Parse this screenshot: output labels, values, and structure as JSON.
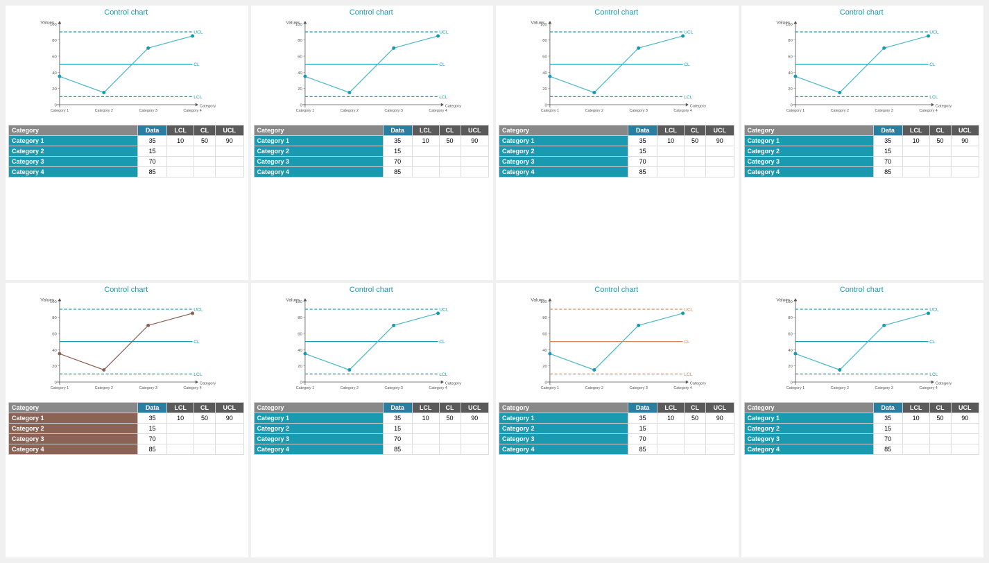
{
  "charts": [
    {
      "id": "c1",
      "title": "Control chart",
      "theme": "teal",
      "lineColor": "#4ab8c8",
      "pointColor": "#1a9ab0",
      "data": [
        35,
        15,
        70,
        85
      ],
      "lcl": 10,
      "cl": 50,
      "ucl": 90,
      "clColor": "#1a9ab0",
      "uclColor": "#1a9ab0",
      "lclColor": "#1a9ab0"
    },
    {
      "id": "c2",
      "title": "Control chart",
      "theme": "teal",
      "lineColor": "#4ab8c8",
      "pointColor": "#1a9ab0",
      "data": [
        35,
        15,
        70,
        85
      ],
      "lcl": 10,
      "cl": 50,
      "ucl": 90,
      "clColor": "#1a9ab0",
      "uclColor": "#1a9ab0",
      "lclColor": "#1a9ab0"
    },
    {
      "id": "c3",
      "title": "Control chart",
      "theme": "teal",
      "lineColor": "#4ab8c8",
      "pointColor": "#1a9ab0",
      "data": [
        35,
        15,
        70,
        85
      ],
      "lcl": 10,
      "cl": 50,
      "ucl": 90,
      "clColor": "#1a9ab0",
      "uclColor": "#1a9ab0",
      "lclColor": "#1a9ab0"
    },
    {
      "id": "c4",
      "title": "Control chart",
      "theme": "teal",
      "lineColor": "#4ab8c8",
      "pointColor": "#1a9ab0",
      "data": [
        35,
        15,
        70,
        85
      ],
      "lcl": 10,
      "cl": 50,
      "ucl": 90,
      "clColor": "#1a9ab0",
      "uclColor": "#1a9ab0",
      "lclColor": "#1a9ab0"
    },
    {
      "id": "c5",
      "title": "Control chart",
      "theme": "brown",
      "lineColor": "#8b6355",
      "pointColor": "#8b6355",
      "data": [
        35,
        15,
        70,
        85
      ],
      "lcl": 10,
      "cl": 50,
      "ucl": 90,
      "clColor": "#1a9ab0",
      "uclColor": "#1a9ab0",
      "lclColor": "#1a9ab0"
    },
    {
      "id": "c6",
      "title": "Control chart",
      "theme": "teal",
      "lineColor": "#4ab8c8",
      "pointColor": "#1a9ab0",
      "data": [
        35,
        15,
        70,
        85
      ],
      "lcl": 10,
      "cl": 50,
      "ucl": 90,
      "clColor": "#1a9ab0",
      "uclColor": "#1a9ab0",
      "lclColor": "#1a9ab0"
    },
    {
      "id": "c7",
      "title": "Control chart",
      "theme": "teal",
      "lineColor": "#4ab8c8",
      "pointColor": "#1a9ab0",
      "data": [
        35,
        15,
        70,
        85
      ],
      "lcl": 10,
      "cl": 50,
      "ucl": 90,
      "clColor": "#d4875a",
      "uclColor": "#d4875a",
      "lclColor": "#d4875a"
    },
    {
      "id": "c8",
      "title": "Control chart",
      "theme": "teal",
      "lineColor": "#4ab8c8",
      "pointColor": "#1a9ab0",
      "data": [
        35,
        15,
        70,
        85
      ],
      "lcl": 10,
      "cl": 50,
      "ucl": 90,
      "clColor": "#1a9ab0",
      "uclColor": "#1a9ab0",
      "lclColor": "#1a9ab0"
    }
  ],
  "categories": [
    "Category 1",
    "Category 2",
    "Category 3",
    "Category 4"
  ],
  "tableHeaders": {
    "category": "Category",
    "data": "Data",
    "lcl": "LCL",
    "cl": "CL",
    "ucl": "UCL"
  },
  "axisLabels": {
    "y": "Values",
    "x": "Category"
  },
  "refLabels": {
    "ucl": "UCL",
    "cl": "CL",
    "lcl": "LCL"
  }
}
